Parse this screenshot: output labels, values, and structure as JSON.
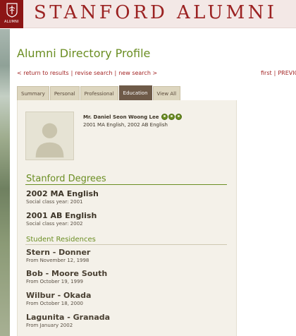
{
  "header": {
    "logo_text": "ALUMNI",
    "site_title": "STANFORD ALUMNI"
  },
  "page_title": "Alumni Directory Profile",
  "nav": {
    "return": "< return to results",
    "revise": "revise search",
    "new_search": "new search >",
    "first": "first",
    "previous": "PREVIO"
  },
  "tabs": [
    {
      "label": "Summary",
      "active": false
    },
    {
      "label": "Personal",
      "active": false
    },
    {
      "label": "Professional",
      "active": false
    },
    {
      "label": "Education",
      "active": true
    },
    {
      "label": "View All",
      "active": false
    }
  ],
  "profile": {
    "name": "Mr. Daniel Seon Woong Lee",
    "degrees_summary": "2001 MA English, 2002 AB English",
    "badges": [
      "alumni-badge-icon",
      "alumni-badge-icon",
      "alumni-badge-icon"
    ]
  },
  "degrees": {
    "heading": "Stanford Degrees",
    "items": [
      {
        "title": "2002 MA English",
        "sub": "Social class year: 2001"
      },
      {
        "title": "2001 AB English",
        "sub": "Social class year: 2002"
      }
    ]
  },
  "residences": {
    "heading": "Student Residences",
    "items": [
      {
        "title": "Stern - Donner",
        "sub": "From November 12, 1998"
      },
      {
        "title": "Bob - Moore South",
        "sub": "From October 19, 1999"
      },
      {
        "title": "Wilbur - Okada",
        "sub": "From October 18, 2000"
      },
      {
        "title": "Lagunita - Granada",
        "sub": "From January 2002"
      }
    ]
  },
  "colors": {
    "brand": "#8c1515",
    "accent_green": "#6b8e23",
    "active_tab": "#6e5a48",
    "panel_bg": "#f4f1e9"
  }
}
